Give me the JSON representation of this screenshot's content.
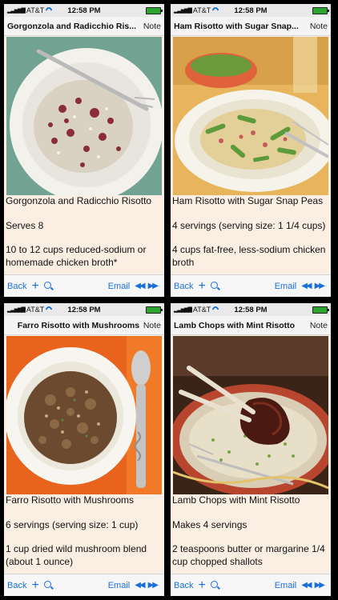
{
  "status": {
    "carrier": "AT&T",
    "time": "12:58 PM"
  },
  "phones": [
    {
      "title": "Gorgonzola and Radicchio Ris...",
      "note": "Note",
      "lines": [
        "Gorgonzola and Radicchio Risotto",
        "Serves 8",
        "10 to 12 cups reduced-sodium or homemade chicken broth*"
      ],
      "photo": "risotto-radicchio-white-plate-fork"
    },
    {
      "title": "Ham Risotto with Sugar Snap...",
      "note": "Note",
      "lines": [
        "Ham Risotto with Sugar Snap Peas",
        "4 servings (serving size: 1 1/4 cups)",
        "4 cups fat-free, less-sodium chicken broth"
      ],
      "photo": "ham-risotto-peas-white-plate-fork"
    },
    {
      "title": "Farro Risotto with Mushrooms",
      "note": "Note",
      "lines": [
        "Farro Risotto with Mushrooms",
        "6 servings (serving size: 1 cup)",
        "1 cup dried wild mushroom blend (about 1 ounce)"
      ],
      "photo": "farro-mushrooms-orange-background-spoon"
    },
    {
      "title": "Lamb Chops with Mint Risotto",
      "note": "Note",
      "lines": [
        "Lamb Chops with Mint Risotto",
        "Makes 4 servings",
        "2 teaspoons butter or margarine 1/4 cup chopped shallots"
      ],
      "photo": "lamb-chop-risotto-decorative-plate"
    }
  ],
  "toolbar": {
    "back": "Back",
    "plus": "+",
    "email": "Email",
    "prev": "◀◀",
    "next": "▶▶"
  },
  "icons": {
    "search": "search-icon",
    "wifi": "wifi-icon",
    "battery": "battery-icon",
    "signal": "signal-icon"
  },
  "colors": {
    "accent": "#1a6fd9",
    "page_bg": "#fbeee2",
    "battery": "#2ea52e"
  }
}
